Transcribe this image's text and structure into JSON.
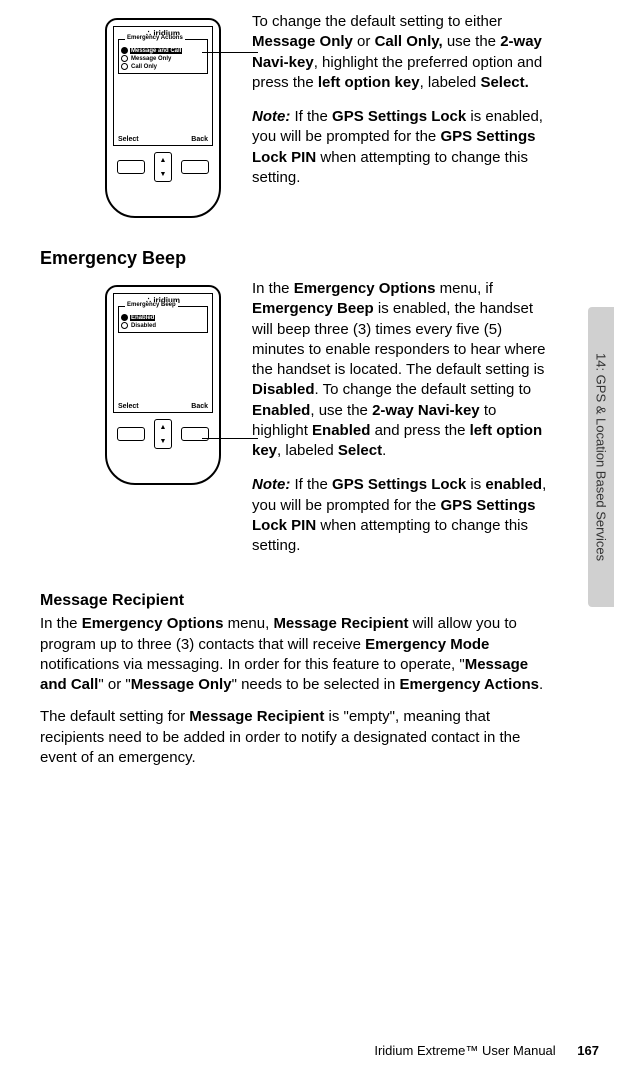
{
  "sideTab": "14: GPS & Location Based Services",
  "device1": {
    "brand": "iridium",
    "menuTitle": "Emergency Actions",
    "items": [
      "Message and Call",
      "Message Only",
      "Call Only"
    ],
    "softLeft": "Select",
    "softRight": "Back"
  },
  "section1": {
    "p1_a": "To change the default setting to either ",
    "p1_b": "Message Only",
    "p1_c": " or ",
    "p1_d": "Call Only,",
    "p1_e": " use the ",
    "p1_f": "2-way Navi-key",
    "p1_g": ", highlight the preferred option and press the ",
    "p1_h": "left option key",
    "p1_i": ", labeled ",
    "p1_j": "Select.",
    "p2_a": "Note:",
    "p2_b": " If the ",
    "p2_c": "GPS Settings Lock",
    "p2_d": " is enabled, you will be prompted for the ",
    "p2_e": "GPS Settings Lock PIN",
    "p2_f": " when attempting to change this setting."
  },
  "heading2": "Emergency Beep",
  "device2": {
    "brand": "iridium",
    "menuTitle": "Emergency Beep",
    "items": [
      "Enabled",
      "Disabled"
    ],
    "softLeft": "Select",
    "softRight": "Back"
  },
  "section2": {
    "p1_a": "In the ",
    "p1_b": "Emergency Options",
    "p1_c": " menu, if ",
    "p1_d": "Emergency Beep",
    "p1_e": " is enabled, the handset will beep three (3) times every five (5) minutes to enable responders to hear where the handset is located. The default setting is ",
    "p1_f": "Disabled",
    "p1_g": ". To change the default setting to ",
    "p1_h": "Enabled",
    "p1_i": ", use the ",
    "p1_j": "2-way Navi-key",
    "p1_k": " to highlight ",
    "p1_l": "Enabled",
    "p1_m": " and press the ",
    "p1_n": "left option key",
    "p1_o": ", labeled ",
    "p1_p": "Select",
    "p1_q": ".",
    "p2_a": "Note:",
    "p2_b": " If the ",
    "p2_c": "GPS Settings Lock",
    "p2_d": " is ",
    "p2_e": "enabled",
    "p2_f": ", you will be prompted for the ",
    "p2_g": "GPS Settings Lock PIN",
    "p2_h": " when attempting to change this setting."
  },
  "heading3": "Message Recipient",
  "section3": {
    "p1_a": "In the ",
    "p1_b": "Emergency Options",
    "p1_c": " menu, ",
    "p1_d": "Message Recipient",
    "p1_e": " will allow you to program up to three (3) contacts that will receive ",
    "p1_f": "Emergency Mode",
    "p1_g": " notifications via messaging. In order for this feature to operate, \"",
    "p1_h": "Message and Call",
    "p1_i": "\" or \"",
    "p1_j": "Message Only",
    "p1_k": "\" needs to be selected in ",
    "p1_l": "Emergency Actions",
    "p1_m": ".",
    "p2_a": "The default setting for ",
    "p2_b": "Message Recipient",
    "p2_c": " is \"empty\", meaning that recipients need to be added in order to notify a designated contact in the event of an emergency."
  },
  "footer": {
    "title": "Iridium Extreme™ User Manual",
    "page": "167"
  }
}
